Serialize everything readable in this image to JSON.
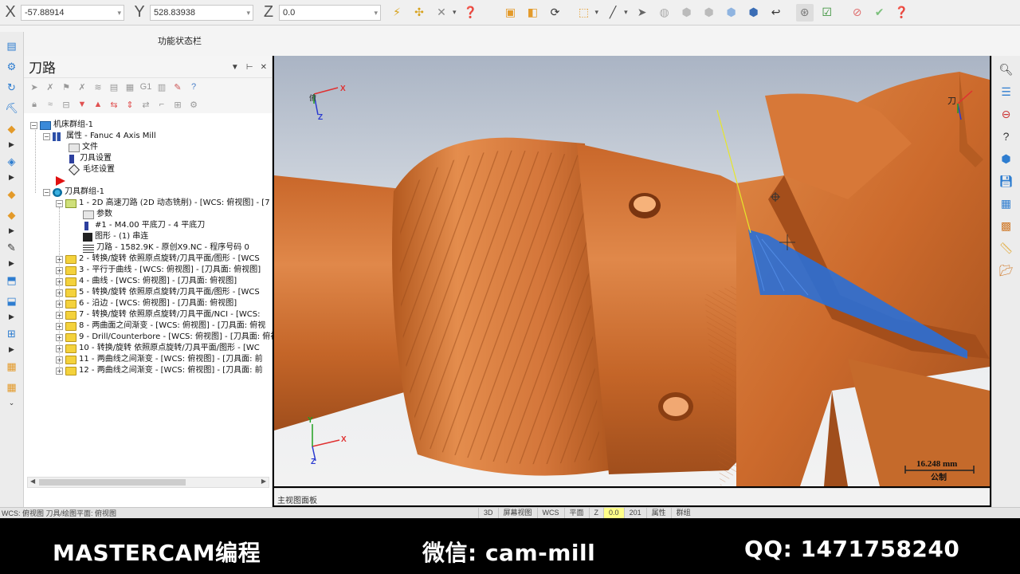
{
  "coords": {
    "x_label": "X",
    "x_value": "-57.88914",
    "y_label": "Y",
    "y_value": "528.83938",
    "z_label": "Z",
    "z_value": "0.0"
  },
  "function_status": "功能状态栏",
  "panel": {
    "title": "刀路",
    "tree": [
      {
        "label": "机床群组-1"
      },
      {
        "label": "属性 - Fanuc 4 Axis Mill"
      },
      {
        "label": "文件"
      },
      {
        "label": "刀具设置"
      },
      {
        "label": "毛坯设置"
      },
      {
        "label": "刀具群组-1"
      },
      {
        "label": "1 - 2D 高速刀路 (2D 动态铣削) - [WCS: 俯视图] - [7"
      },
      {
        "label": "参数"
      },
      {
        "label": "#1 - M4.00 平底刀 - 4 平底刀"
      },
      {
        "label": "图形 - (1) 串连"
      },
      {
        "label": "刀路 - 1582.9K - 原创X9.NC - 程序号码 0"
      },
      {
        "label": "2 - 转换/旋转 依照原点旋转/刀具平面/图形 - [WCS"
      },
      {
        "label": "3 - 平行于曲线 - [WCS: 俯视图] - [刀具面: 俯视图]"
      },
      {
        "label": "4 - 曲线 - [WCS: 俯视图] - [刀具面: 俯视图]"
      },
      {
        "label": "5 - 转换/旋转 依照原点旋转/刀具平面/图形 - [WCS"
      },
      {
        "label": "6 - 沿边 - [WCS: 俯视图] - [刀具面: 俯视图]"
      },
      {
        "label": "7 - 转换/旋转 依照原点旋转/刀具平面/NCI - [WCS:"
      },
      {
        "label": "8 - 两曲面之间渐变 - [WCS: 俯视图] - [刀具面: 俯视"
      },
      {
        "label": "9 - Drill/Counterbore - [WCS: 俯视图] - [刀具面: 俯视"
      },
      {
        "label": "10 - 转换/旋转 依照原点旋转/刀具平面/图形 - [WC"
      },
      {
        "label": "11 - 两曲线之间渐变 - [WCS: 俯视图] - [刀具面: 前"
      },
      {
        "label": "12 - 两曲线之间渐变 - [WCS: 俯视图] - [刀具面: 前"
      }
    ]
  },
  "viewport": {
    "axis_x": "X",
    "axis_y": "Y",
    "axis_z": "Z",
    "wcs_label": "俯",
    "tool_label": "刀",
    "scale_value": "16.248 mm",
    "scale_unit": "公制",
    "tab_label": "主视图面板"
  },
  "statusbar": {
    "left_text": "WCS: 俯视图 刀具/绘图平面: 俯视图",
    "items": [
      "3D",
      "屏幕视图",
      "WCS",
      "平面",
      "Z",
      "0.0",
      "201",
      "属性",
      "群组"
    ]
  },
  "banner": {
    "left": "MASTERCAM编程",
    "middle": "微信: cam-mill",
    "right": "QQ: 1471758240"
  },
  "colors": {
    "part": "#d2742f",
    "toolpath": "#2a6fd6",
    "banner_bg": "#000000"
  }
}
